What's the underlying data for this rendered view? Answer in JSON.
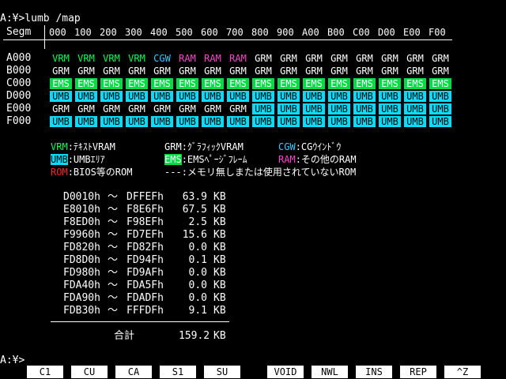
{
  "prompt_line": "A:¥>lumb /map",
  "header": {
    "segm_label": "Segm",
    "columns": [
      "000",
      "100",
      "200",
      "300",
      "400",
      "500",
      "600",
      "700",
      "800",
      "900",
      "A00",
      "B00",
      "C00",
      "D00",
      "E00",
      "F00"
    ]
  },
  "rows": [
    {
      "seg": "A000",
      "cells": [
        "VRM",
        "VRM",
        "VRM",
        "VRM",
        "CGW",
        "RAM",
        "RAM",
        "RAM",
        "GRM",
        "GRM",
        "GRM",
        "GRM",
        "GRM",
        "GRM",
        "GRM",
        "GRM"
      ]
    },
    {
      "seg": "B000",
      "cells": [
        "GRM",
        "GRM",
        "GRM",
        "GRM",
        "GRM",
        "GRM",
        "GRM",
        "GRM",
        "GRM",
        "GRM",
        "GRM",
        "GRM",
        "GRM",
        "GRM",
        "GRM",
        "GRM"
      ]
    },
    {
      "seg": "C000",
      "cells": [
        "EMS",
        "EMS",
        "EMS",
        "EMS",
        "EMS",
        "EMS",
        "EMS",
        "EMS",
        "EMS",
        "EMS",
        "EMS",
        "EMS",
        "EMS",
        "EMS",
        "EMS",
        "EMS"
      ]
    },
    {
      "seg": "D000",
      "cells": [
        "UMB",
        "UMB",
        "UMB",
        "UMB",
        "UMB",
        "UMB",
        "UMB",
        "UMB",
        "UMB",
        "UMB",
        "UMB",
        "UMB",
        "UMB",
        "UMB",
        "UMB",
        "UMB"
      ]
    },
    {
      "seg": "E000",
      "cells": [
        "GRM",
        "GRM",
        "GRM",
        "GRM",
        "GRM",
        "GRM",
        "GRM",
        "GRM",
        "UMB",
        "UMB",
        "UMB",
        "UMB",
        "UMB",
        "UMB",
        "UMB",
        "UMB"
      ]
    },
    {
      "seg": "F000",
      "cells": [
        "UMB",
        "UMB",
        "UMB",
        "UMB",
        "UMB",
        "UMB",
        "UMB",
        "UMB",
        "UMB",
        "UMB",
        "UMB",
        "UMB",
        "UMB",
        "UMB",
        "UMB",
        "UMB"
      ]
    }
  ],
  "legend": {
    "vrm_key": "VRM",
    "vrm_desc": ":ﾃｷｽﾄVRAM",
    "grm_key": "GRM",
    "grm_desc": ":ｸﾞﾗﾌｨｯｸVRAM",
    "cgw_key": "CGW",
    "cgw_desc": ":CGｳｲﾝﾄﾞｳ",
    "umb_key": "UMB",
    "umb_desc": ":UMBｴﾘｱ",
    "ems_key": "EMS",
    "ems_desc": ":EMSﾍﾟｰｼﾞﾌﾚｰﾑ",
    "ram_key": "RAM",
    "ram_desc": ":その他のRAM",
    "rom_key": "ROM",
    "rom_desc": ":BIOS等のROM",
    "none_key": "---",
    "none_desc": ":メモリ無しまたは使用されていないROM"
  },
  "ranges": [
    {
      "start": "D0010h",
      "sep": "～",
      "end": "DFFEFh",
      "size": "63.9",
      "unit": "KB"
    },
    {
      "start": "E8010h",
      "sep": "～",
      "end": "F8E6Fh",
      "size": "67.5",
      "unit": "KB"
    },
    {
      "start": "F8ED0h",
      "sep": "～",
      "end": "F98EFh",
      "size": "2.5",
      "unit": "KB"
    },
    {
      "start": "F9960h",
      "sep": "～",
      "end": "FD7EFh",
      "size": "15.6",
      "unit": "KB"
    },
    {
      "start": "FD820h",
      "sep": "～",
      "end": "FD82Fh",
      "size": "0.0",
      "unit": "KB"
    },
    {
      "start": "FD8D0h",
      "sep": "～",
      "end": "FD94Fh",
      "size": "0.1",
      "unit": "KB"
    },
    {
      "start": "FD980h",
      "sep": "～",
      "end": "FD9AFh",
      "size": "0.0",
      "unit": "KB"
    },
    {
      "start": "FDA40h",
      "sep": "～",
      "end": "FDA5Fh",
      "size": "0.0",
      "unit": "KB"
    },
    {
      "start": "FDA90h",
      "sep": "～",
      "end": "FDADFh",
      "size": "0.0",
      "unit": "KB"
    },
    {
      "start": "FDB30h",
      "sep": "～",
      "end": "FFFDFh",
      "size": "9.1",
      "unit": "KB"
    }
  ],
  "total": {
    "label": "合計",
    "size": "159.2",
    "unit": "KB"
  },
  "prompt2": "A:¥>",
  "function_keys": [
    "C1",
    "CU",
    "CA",
    "S1",
    "SU",
    "VOID",
    "NWL",
    "INS",
    "REP",
    "^Z"
  ],
  "colors": {
    "vrm": "#00ff55",
    "ram": "#ff44cc",
    "cgw": "#33ccff",
    "grm": "#ffffff",
    "ems_bg": "#00dd44",
    "umb_bg": "#00ddff",
    "rom": "#ff2222"
  }
}
